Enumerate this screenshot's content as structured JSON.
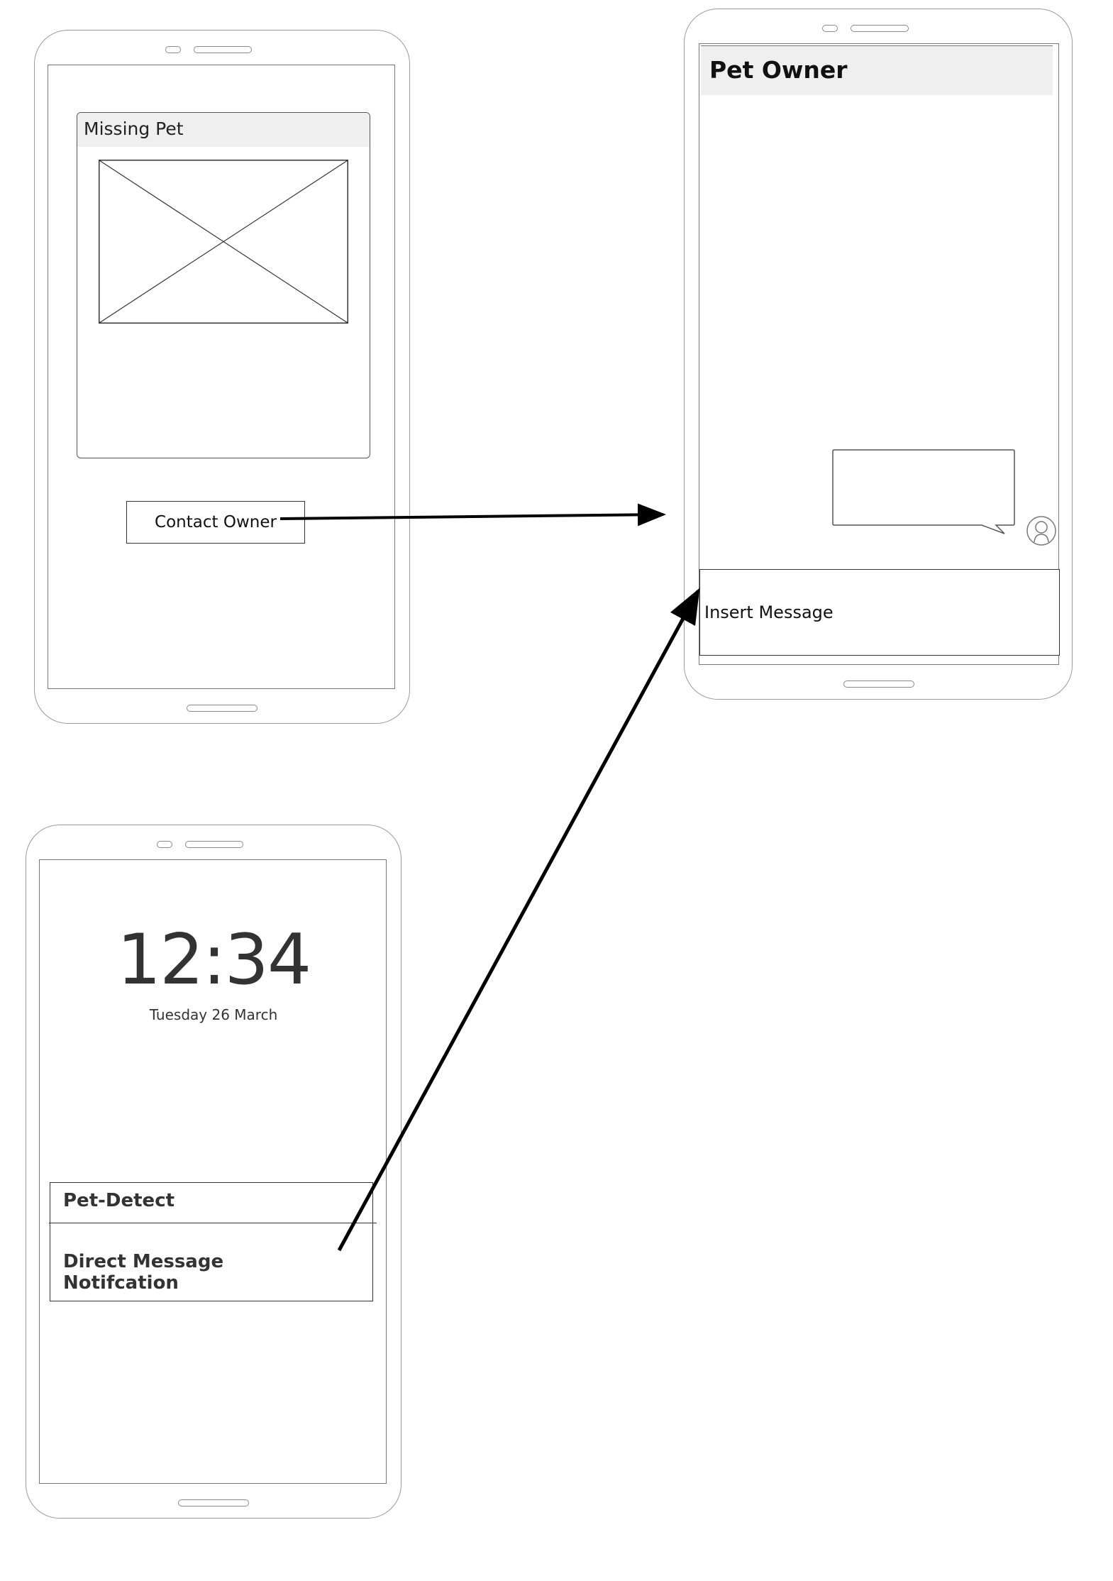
{
  "missing_pet_screen": {
    "card_title": "Missing Pet",
    "image_placeholder_icon": "image-placeholder-icon",
    "contact_button_label": "Contact Owner"
  },
  "chat_screen": {
    "header_title": "Pet Owner",
    "bubble_text": "",
    "avatar_icon": "user-avatar-icon",
    "input_placeholder": "Insert Message"
  },
  "lock_screen": {
    "time": "12:34",
    "date": "Tuesday 26 March",
    "notification": {
      "app_name": "Pet-Detect",
      "message": "Direct Message Notifcation"
    }
  },
  "flows": [
    {
      "from": "Contact Owner",
      "to": "Pet Owner chat"
    },
    {
      "from": "Direct Message Notifcation",
      "to": "Insert Message"
    }
  ],
  "colors": {
    "outline": "#9a9a9a",
    "header_fill": "#efefef",
    "arrow": "#000000"
  }
}
